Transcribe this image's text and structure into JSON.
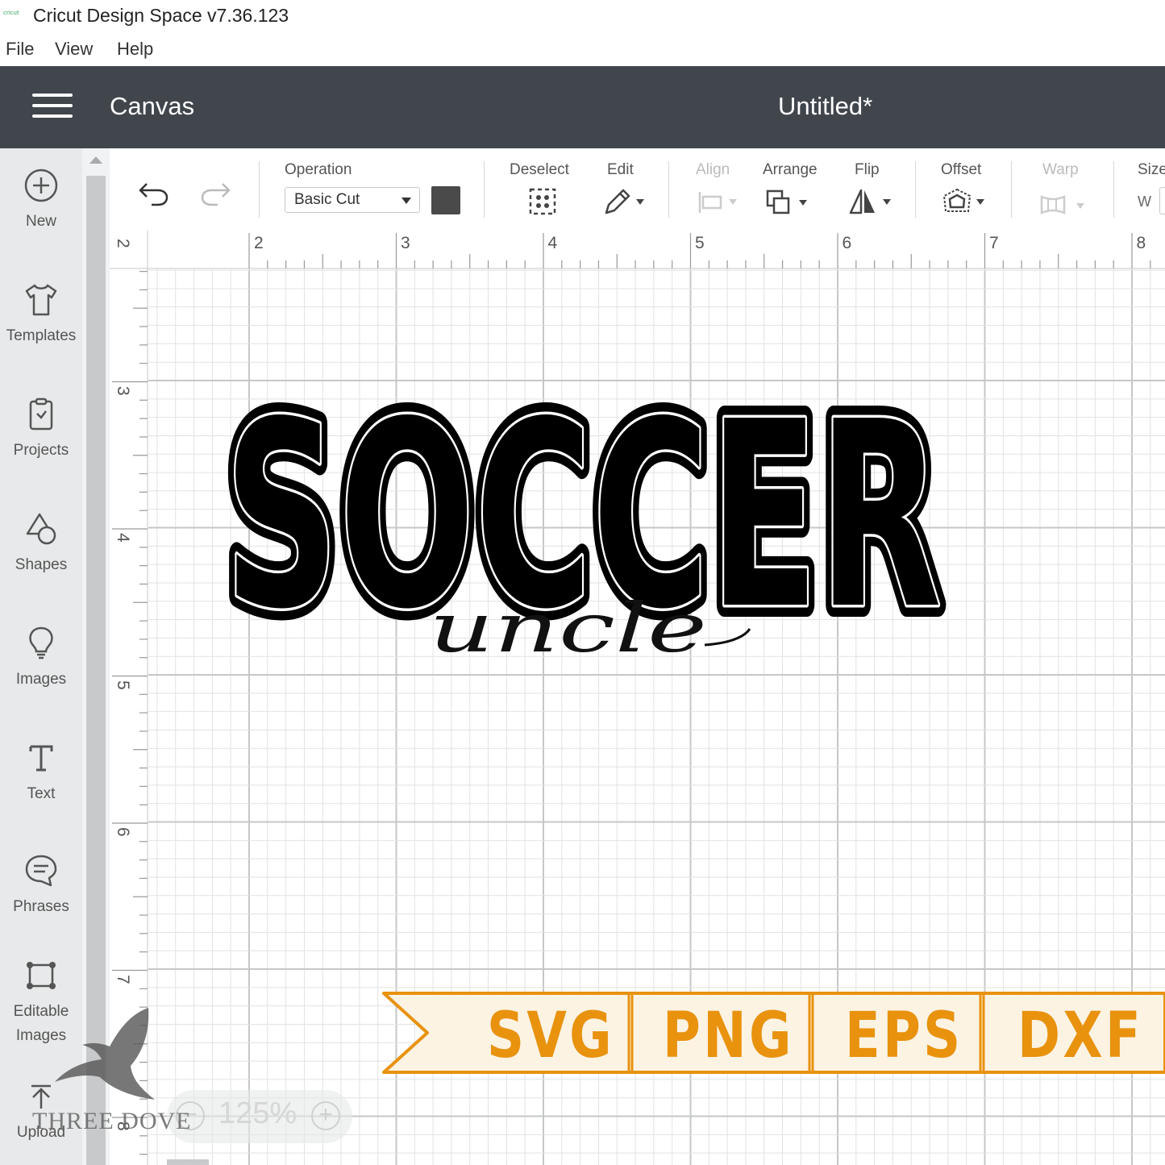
{
  "window": {
    "title": "Cricut Design Space  v7.36.123",
    "icon_text": "cricut"
  },
  "menu": [
    "File",
    "View",
    "Help"
  ],
  "header": {
    "section": "Canvas",
    "document_title": "Untitled*"
  },
  "sidebar": {
    "items": [
      {
        "label": "New",
        "icon": "plus-circle-icon"
      },
      {
        "label": "Templates",
        "icon": "tshirt-icon"
      },
      {
        "label": "Projects",
        "icon": "projects-icon"
      },
      {
        "label": "Shapes",
        "icon": "shapes-icon"
      },
      {
        "label": "Images",
        "icon": "lightbulb-icon"
      },
      {
        "label": "Text",
        "icon": "text-icon"
      },
      {
        "label": "Phrases",
        "icon": "speech-bubble-icon"
      },
      {
        "label": "Editable",
        "label2": "Images",
        "icon": "editable-images-icon"
      },
      {
        "label": "Upload",
        "icon": "upload-icon"
      }
    ]
  },
  "toolbar": {
    "operation_label": "Operation",
    "operation_value": "Basic Cut",
    "operation_color": "#4a4a4a",
    "deselect": "Deselect",
    "edit": "Edit",
    "align": "Align",
    "arrange": "Arrange",
    "flip": "Flip",
    "offset": "Offset",
    "warp": "Warp",
    "size": "Size",
    "size_w": "W"
  },
  "rulers": {
    "top": [
      "2",
      "3",
      "4",
      "5",
      "6",
      "7",
      "8"
    ],
    "left": [
      "2",
      "3",
      "4",
      "5",
      "6",
      "7",
      "8"
    ]
  },
  "design": {
    "main_text": "SOCCER",
    "script_text": "uncle"
  },
  "banner": {
    "formats": [
      "SVG",
      "PNG",
      "EPS",
      "DXF"
    ],
    "color": "#e8920e"
  },
  "zoom": {
    "value": "125%"
  },
  "watermark": "THREE DOVE"
}
